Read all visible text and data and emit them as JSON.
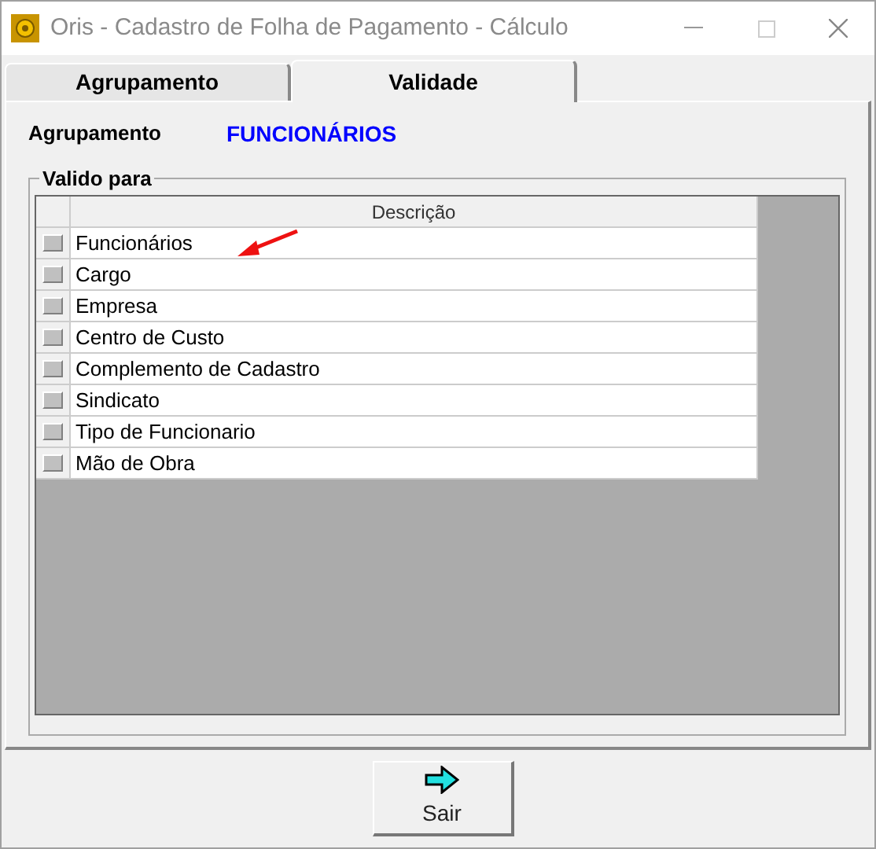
{
  "window": {
    "title": "Oris - Cadastro de Folha de Pagamento - Cálculo"
  },
  "tabs": [
    {
      "label": "Agrupamento",
      "selected": false
    },
    {
      "label": "Validade",
      "selected": true
    }
  ],
  "agrupamento": {
    "label": "Agrupamento",
    "value": "FUNCIONÁRIOS"
  },
  "group_box": {
    "title": "Valido para"
  },
  "table": {
    "columns": [
      "Descrição"
    ],
    "rows": [
      {
        "text": "Funcionários"
      },
      {
        "text": "Cargo"
      },
      {
        "text": "Empresa"
      },
      {
        "text": "Centro de Custo"
      },
      {
        "text": "Complemento de Cadastro"
      },
      {
        "text": "Sindicato"
      },
      {
        "text": "Tipo de Funcionario"
      },
      {
        "text": "Mão de Obra"
      }
    ]
  },
  "buttons": [
    {
      "label": "Sair"
    }
  ]
}
